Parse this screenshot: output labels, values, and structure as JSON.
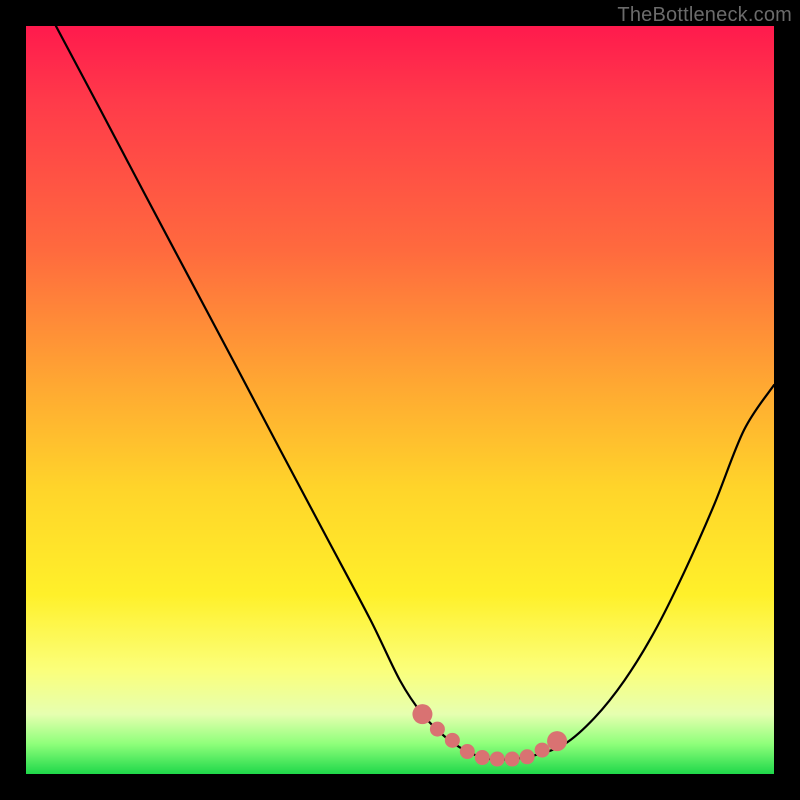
{
  "watermark": "TheBottleneck.com",
  "chart_data": {
    "type": "line",
    "title": "",
    "xlabel": "",
    "ylabel": "",
    "xlim": [
      0,
      100
    ],
    "ylim": [
      0,
      100
    ],
    "grid": false,
    "series": [
      {
        "name": "curve",
        "color": "#000000",
        "x": [
          4,
          10,
          16,
          22,
          28,
          34,
          40,
          46,
          50,
          53,
          56,
          59,
          62,
          65,
          68,
          72,
          76,
          80,
          84,
          88,
          92,
          96,
          100
        ],
        "y": [
          100,
          88.7,
          77.3,
          66.0,
          54.7,
          43.3,
          32.0,
          20.7,
          12.5,
          8.0,
          5.0,
          3.0,
          2.0,
          2.0,
          2.5,
          4.0,
          7.5,
          12.5,
          19.0,
          27.0,
          36.0,
          46.0,
          52.0
        ]
      }
    ],
    "highlight": {
      "name": "bottom-dots",
      "color": "#d97272",
      "x": [
        53,
        55,
        57,
        59,
        61,
        63,
        65,
        67,
        69,
        71
      ],
      "y": [
        8.0,
        6.0,
        4.5,
        3.0,
        2.2,
        2.0,
        2.0,
        2.3,
        3.2,
        4.4
      ]
    },
    "background_gradient": {
      "stops": [
        {
          "pos": 0,
          "color": "#ff1a4d"
        },
        {
          "pos": 30,
          "color": "#ff6a3e"
        },
        {
          "pos": 62,
          "color": "#ffd52a"
        },
        {
          "pos": 86,
          "color": "#fbff7a"
        },
        {
          "pos": 100,
          "color": "#1fd84a"
        }
      ]
    }
  }
}
